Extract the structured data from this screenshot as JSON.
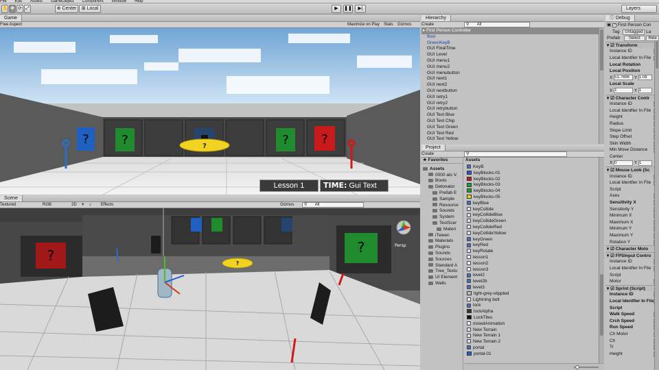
{
  "menu": [
    "File",
    "Edit",
    "Assets",
    "GameObject",
    "Component",
    "Window",
    "Help"
  ],
  "toolbar": {
    "center": "Center",
    "local": "Local",
    "layers": "Layers"
  },
  "game": {
    "tab": "Game",
    "aspect": "Free Aspect",
    "maximize": "Maximize on Play",
    "stats": "Stats",
    "gizmos": "Gizmos",
    "lesson": "Lesson 1",
    "time_label": "TIME:",
    "time_value": "Gui Text"
  },
  "scene": {
    "tab": "Scene",
    "shading": "Textured",
    "rgb": "RGB",
    "mode2d": "2D",
    "effects": "Effects",
    "gizmos": "Gizmos",
    "search": "All",
    "persp": "Persp"
  },
  "hierarchy": {
    "tab": "Hierarchy",
    "create": "Create",
    "search": "All",
    "items": [
      {
        "label": "First Person Controller",
        "style": "sel"
      },
      {
        "label": "floor",
        "style": "blue"
      },
      {
        "label": "GreenKeyB",
        "style": "blue"
      },
      {
        "label": "GUI FinalTime",
        "style": ""
      },
      {
        "label": "GUI Level",
        "style": ""
      },
      {
        "label": "GUI menu1",
        "style": ""
      },
      {
        "label": "GUI menu2",
        "style": ""
      },
      {
        "label": "GUI menubutton",
        "style": ""
      },
      {
        "label": "GUI next1",
        "style": ""
      },
      {
        "label": "GUI next2",
        "style": ""
      },
      {
        "label": "GUI nextbutton",
        "style": ""
      },
      {
        "label": "GUI retry1",
        "style": ""
      },
      {
        "label": "GUI retry2",
        "style": ""
      },
      {
        "label": "GUI retrybutton",
        "style": ""
      },
      {
        "label": "GUI Text Blue",
        "style": ""
      },
      {
        "label": "GUI Text Chip",
        "style": ""
      },
      {
        "label": "GUI Text Green",
        "style": ""
      },
      {
        "label": "GUI Text Red",
        "style": ""
      },
      {
        "label": "GUI Text Yellow",
        "style": ""
      }
    ]
  },
  "project": {
    "tab": "Project",
    "create": "Create",
    "favorites": "Favorites",
    "assets_header": "Assets",
    "folders": [
      "Assets",
      "0000 ats V.",
      "Boots",
      "Detonator",
      "Prefab E",
      "Sample",
      "Resource",
      "Sounds",
      "System",
      "TestScer",
      "Materi",
      "iTween",
      "Materials",
      "Plugins",
      "Sounds",
      "Sources",
      "Standard A",
      "Tree_Textu",
      "UI Element",
      "Walls"
    ],
    "files": [
      {
        "label": "KeyB",
        "kind": "icon",
        "color": "#4a6fb5"
      },
      {
        "label": "keyBlocks-01",
        "kind": "swatch",
        "color": "#2a5cd0"
      },
      {
        "label": "keyBlocks-02",
        "kind": "swatch",
        "color": "#d01818"
      },
      {
        "label": "keyBlocks-03",
        "kind": "swatch",
        "color": "#18a030"
      },
      {
        "label": "keyBlocks-04",
        "kind": "swatch",
        "color": "#18a030"
      },
      {
        "label": "keyBlocks-05",
        "kind": "swatch",
        "color": "#e8d818"
      },
      {
        "label": "keyBlue",
        "kind": "icon",
        "color": "#4a6fb5"
      },
      {
        "label": "keyCollide",
        "kind": "icon",
        "color": "#dde"
      },
      {
        "label": "keyCollideBlue",
        "kind": "icon",
        "color": "#dde"
      },
      {
        "label": "keyCollideGreen",
        "kind": "icon",
        "color": "#dde"
      },
      {
        "label": "keyCollideRed",
        "kind": "icon",
        "color": "#dde"
      },
      {
        "label": "keyCollideYellow",
        "kind": "icon",
        "color": "#dde"
      },
      {
        "label": "keyGreen",
        "kind": "icon",
        "color": "#4a6fb5"
      },
      {
        "label": "keyRed",
        "kind": "icon",
        "color": "#4a6fb5"
      },
      {
        "label": "keyRotate",
        "kind": "icon",
        "color": "#dde"
      },
      {
        "label": "lesson1",
        "kind": "icon",
        "color": "#eee"
      },
      {
        "label": "lesson2",
        "kind": "icon",
        "color": "#eee"
      },
      {
        "label": "lesson3",
        "kind": "icon",
        "color": "#eee"
      },
      {
        "label": "level2",
        "kind": "icon",
        "color": "#4a6fb5"
      },
      {
        "label": "level2b",
        "kind": "icon",
        "color": "#4a6fb5"
      },
      {
        "label": "level3",
        "kind": "icon",
        "color": "#4a6fb5"
      },
      {
        "label": "light-grey-stippled",
        "kind": "swatch",
        "color": "#bdbdbd"
      },
      {
        "label": "Lightning bolt",
        "kind": "icon",
        "color": "#eee"
      },
      {
        "label": "lock",
        "kind": "icon",
        "color": "#4a6fb5"
      },
      {
        "label": "lockAlpha",
        "kind": "swatch",
        "color": "#333"
      },
      {
        "label": "LockTiles",
        "kind": "swatch",
        "color": "#111"
      },
      {
        "label": "mixedAnimation",
        "kind": "icon",
        "color": "#eee"
      },
      {
        "label": "New Terrain",
        "kind": "icon",
        "color": "#dde"
      },
      {
        "label": "New Terrain 1",
        "kind": "icon",
        "color": "#dde"
      },
      {
        "label": "New Terrain 2",
        "kind": "icon",
        "color": "#dde"
      },
      {
        "label": "portal",
        "kind": "icon",
        "color": "#4a6fb5"
      },
      {
        "label": "portal-01",
        "kind": "swatch",
        "color": "#2a5cd0"
      }
    ]
  },
  "inspector": {
    "tab": "Debug",
    "object_name": "First Person Con",
    "tag_label": "Tag",
    "tag_value": "Untagged",
    "layer_label": "La",
    "prefab_label": "Prefab",
    "select_label": "Select",
    "revert_label": "Rele",
    "rows": [
      {
        "t": "comp",
        "label": "Transform"
      },
      {
        "t": "row",
        "label": "Instance ID",
        "v": "19"
      },
      {
        "t": "row",
        "label": "Local Identfier In File",
        "v": "68"
      },
      {
        "t": "sub",
        "label": "Local Rotation"
      },
      {
        "t": "sub",
        "label": "Local Position"
      },
      {
        "t": "xy",
        "x": "51.7696",
        "y": "1.08"
      },
      {
        "t": "sub",
        "label": "Local Scale"
      },
      {
        "t": "xy",
        "x": "1",
        "y": "1"
      },
      {
        "t": "comp",
        "label": "Character Contr"
      },
      {
        "t": "row",
        "label": "Instance ID",
        "v": "19"
      },
      {
        "t": "row",
        "label": "Local Identfier In File",
        "v": "68"
      },
      {
        "t": "row",
        "label": "Height",
        "v": "2"
      },
      {
        "t": "row",
        "label": "Radius",
        "v": "0."
      },
      {
        "t": "row",
        "label": "Slope Limit",
        "v": "45"
      },
      {
        "t": "row",
        "label": "Step Offset",
        "v": "0."
      },
      {
        "t": "row",
        "label": "Skin Width",
        "v": "0."
      },
      {
        "t": "row",
        "label": "Min Move Distance",
        "v": "0"
      },
      {
        "t": "row",
        "label": "Center",
        "v": ""
      },
      {
        "t": "xy",
        "x": "0",
        "y": "1"
      },
      {
        "t": "comp",
        "label": "Mouse Look (Sc"
      },
      {
        "t": "row",
        "label": "Instance ID",
        "v": "19"
      },
      {
        "t": "row",
        "label": "Local Identfier In File",
        "v": "68"
      },
      {
        "t": "row",
        "label": "Script",
        "v": ""
      },
      {
        "t": "row",
        "label": "Axes",
        "v": "M"
      },
      {
        "t": "bold",
        "label": "Sensitivity X",
        "v": "4"
      },
      {
        "t": "row",
        "label": "Sensitivity Y",
        "v": "0"
      },
      {
        "t": "row",
        "label": "Minimum X",
        "v": "-3"
      },
      {
        "t": "row",
        "label": "Maximum X",
        "v": "36"
      },
      {
        "t": "row",
        "label": "Minimum Y",
        "v": "0"
      },
      {
        "t": "row",
        "label": "Maximum Y",
        "v": "0"
      },
      {
        "t": "row",
        "label": "Rotation Y",
        "v": "0"
      },
      {
        "t": "comp",
        "label": "Character Moto"
      },
      {
        "t": "comp",
        "label": "FPSInput Contro"
      },
      {
        "t": "row",
        "label": "Instance ID",
        "v": "19"
      },
      {
        "t": "row",
        "label": "Local Identfier In File",
        "v": "68"
      },
      {
        "t": "row",
        "label": "Script",
        "v": ""
      },
      {
        "t": "row",
        "label": "Motor",
        "v": "No"
      },
      {
        "t": "comp",
        "label": "Sprint (Script)"
      },
      {
        "t": "bold",
        "label": "Instance ID",
        "v": "19"
      },
      {
        "t": "bold",
        "label": "Local Identfier In File",
        "v": "68"
      },
      {
        "t": "bold",
        "label": "Script",
        "v": ""
      },
      {
        "t": "bold",
        "label": "Walk Speed",
        "v": "5"
      },
      {
        "t": "bold",
        "label": "Crch Speed",
        "v": "3"
      },
      {
        "t": "bold",
        "label": "Run Speed",
        "v": "8"
      },
      {
        "t": "row",
        "label": "Ch Motor",
        "v": "No"
      },
      {
        "t": "row",
        "label": "Ch",
        "v": "No"
      },
      {
        "t": "row",
        "label": "Tr",
        "v": "No"
      },
      {
        "t": "row",
        "label": "Height",
        "v": "0"
      }
    ]
  }
}
